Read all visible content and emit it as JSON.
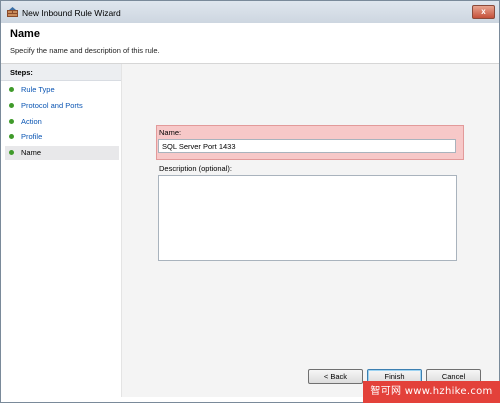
{
  "window": {
    "title": "New Inbound Rule Wizard",
    "close_glyph": "x"
  },
  "header": {
    "title": "Name",
    "subtitle": "Specify the name and description of this rule."
  },
  "steps": {
    "heading": "Steps:",
    "items": [
      {
        "label": "Rule Type"
      },
      {
        "label": "Protocol and Ports"
      },
      {
        "label": "Action"
      },
      {
        "label": "Profile"
      },
      {
        "label": "Name"
      }
    ],
    "current_index": 4
  },
  "form": {
    "name_label": "Name:",
    "name_value": "SQL Server Port 1433",
    "description_label": "Description (optional):",
    "description_value": ""
  },
  "buttons": {
    "back": "< Back",
    "finish": "Finish",
    "cancel": "Cancel"
  },
  "watermark": {
    "text": "智可网 www.hzhike.com"
  },
  "colors": {
    "step_dot": "#3f9a2a",
    "step_link": "#0a55b3",
    "highlight": "#f7c8c8",
    "watermark_bg": "#e3413a"
  }
}
